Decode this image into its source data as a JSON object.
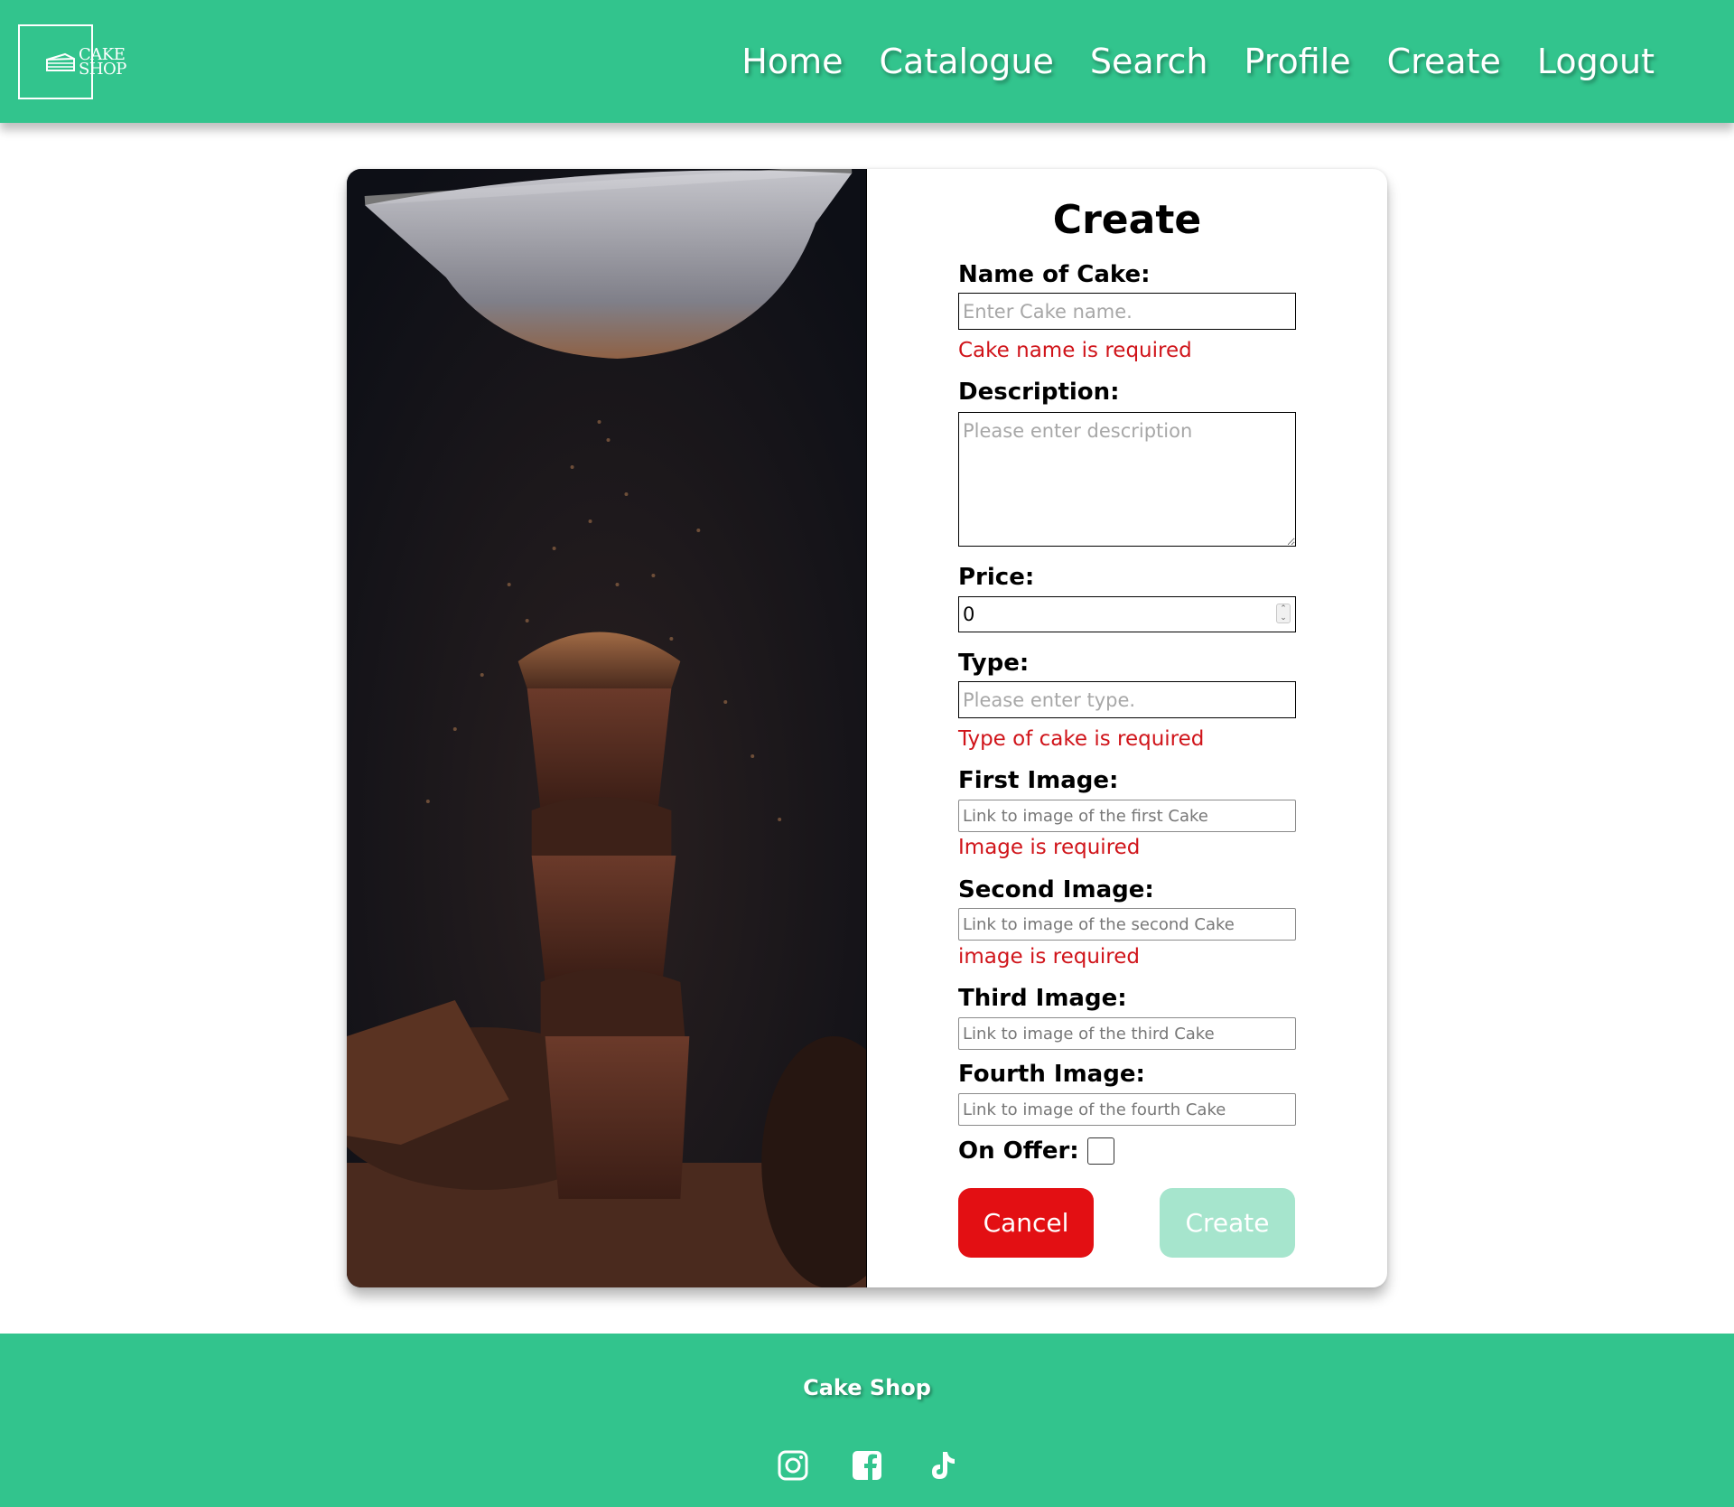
{
  "header": {
    "logo_line1": "CAKE",
    "logo_line2": "SHOP",
    "nav": [
      "Home",
      "Catalogue",
      "Search",
      "Profile",
      "Create",
      "Logout"
    ]
  },
  "form": {
    "title": "Create",
    "name_label": "Name of Cake:",
    "name_placeholder": "Enter Cake name.",
    "name_error": "Cake name is required",
    "description_label": "Description:",
    "description_placeholder": "Please enter description",
    "price_label": "Price:",
    "price_value": "0",
    "type_label": "Type:",
    "type_placeholder": "Please enter type.",
    "type_error": "Type of cake is required",
    "first_image_label": "First Image:",
    "first_image_placeholder": "Link to image of the first Cake",
    "first_image_error": "Image is required",
    "second_image_label": "Second Image:",
    "second_image_placeholder": "Link to image of the second Cake",
    "second_image_error": "image is required",
    "third_image_label": "Third Image:",
    "third_image_placeholder": "Link to image of the third Cake",
    "fourth_image_label": "Fourth Image:",
    "fourth_image_placeholder": "Link to image of the fourth Cake",
    "on_offer_label": "On Offer:",
    "on_offer_checked": false,
    "cancel_label": "Cancel",
    "create_label": "Create"
  },
  "footer": {
    "title": "Cake Shop",
    "social_icons": [
      "instagram-icon",
      "facebook-icon",
      "tiktok-icon"
    ]
  },
  "colors": {
    "brand_green": "#32c48d",
    "error_red": "#d0141a",
    "cancel_red": "#e30f13",
    "create_disabled": "#a6e5cd"
  }
}
